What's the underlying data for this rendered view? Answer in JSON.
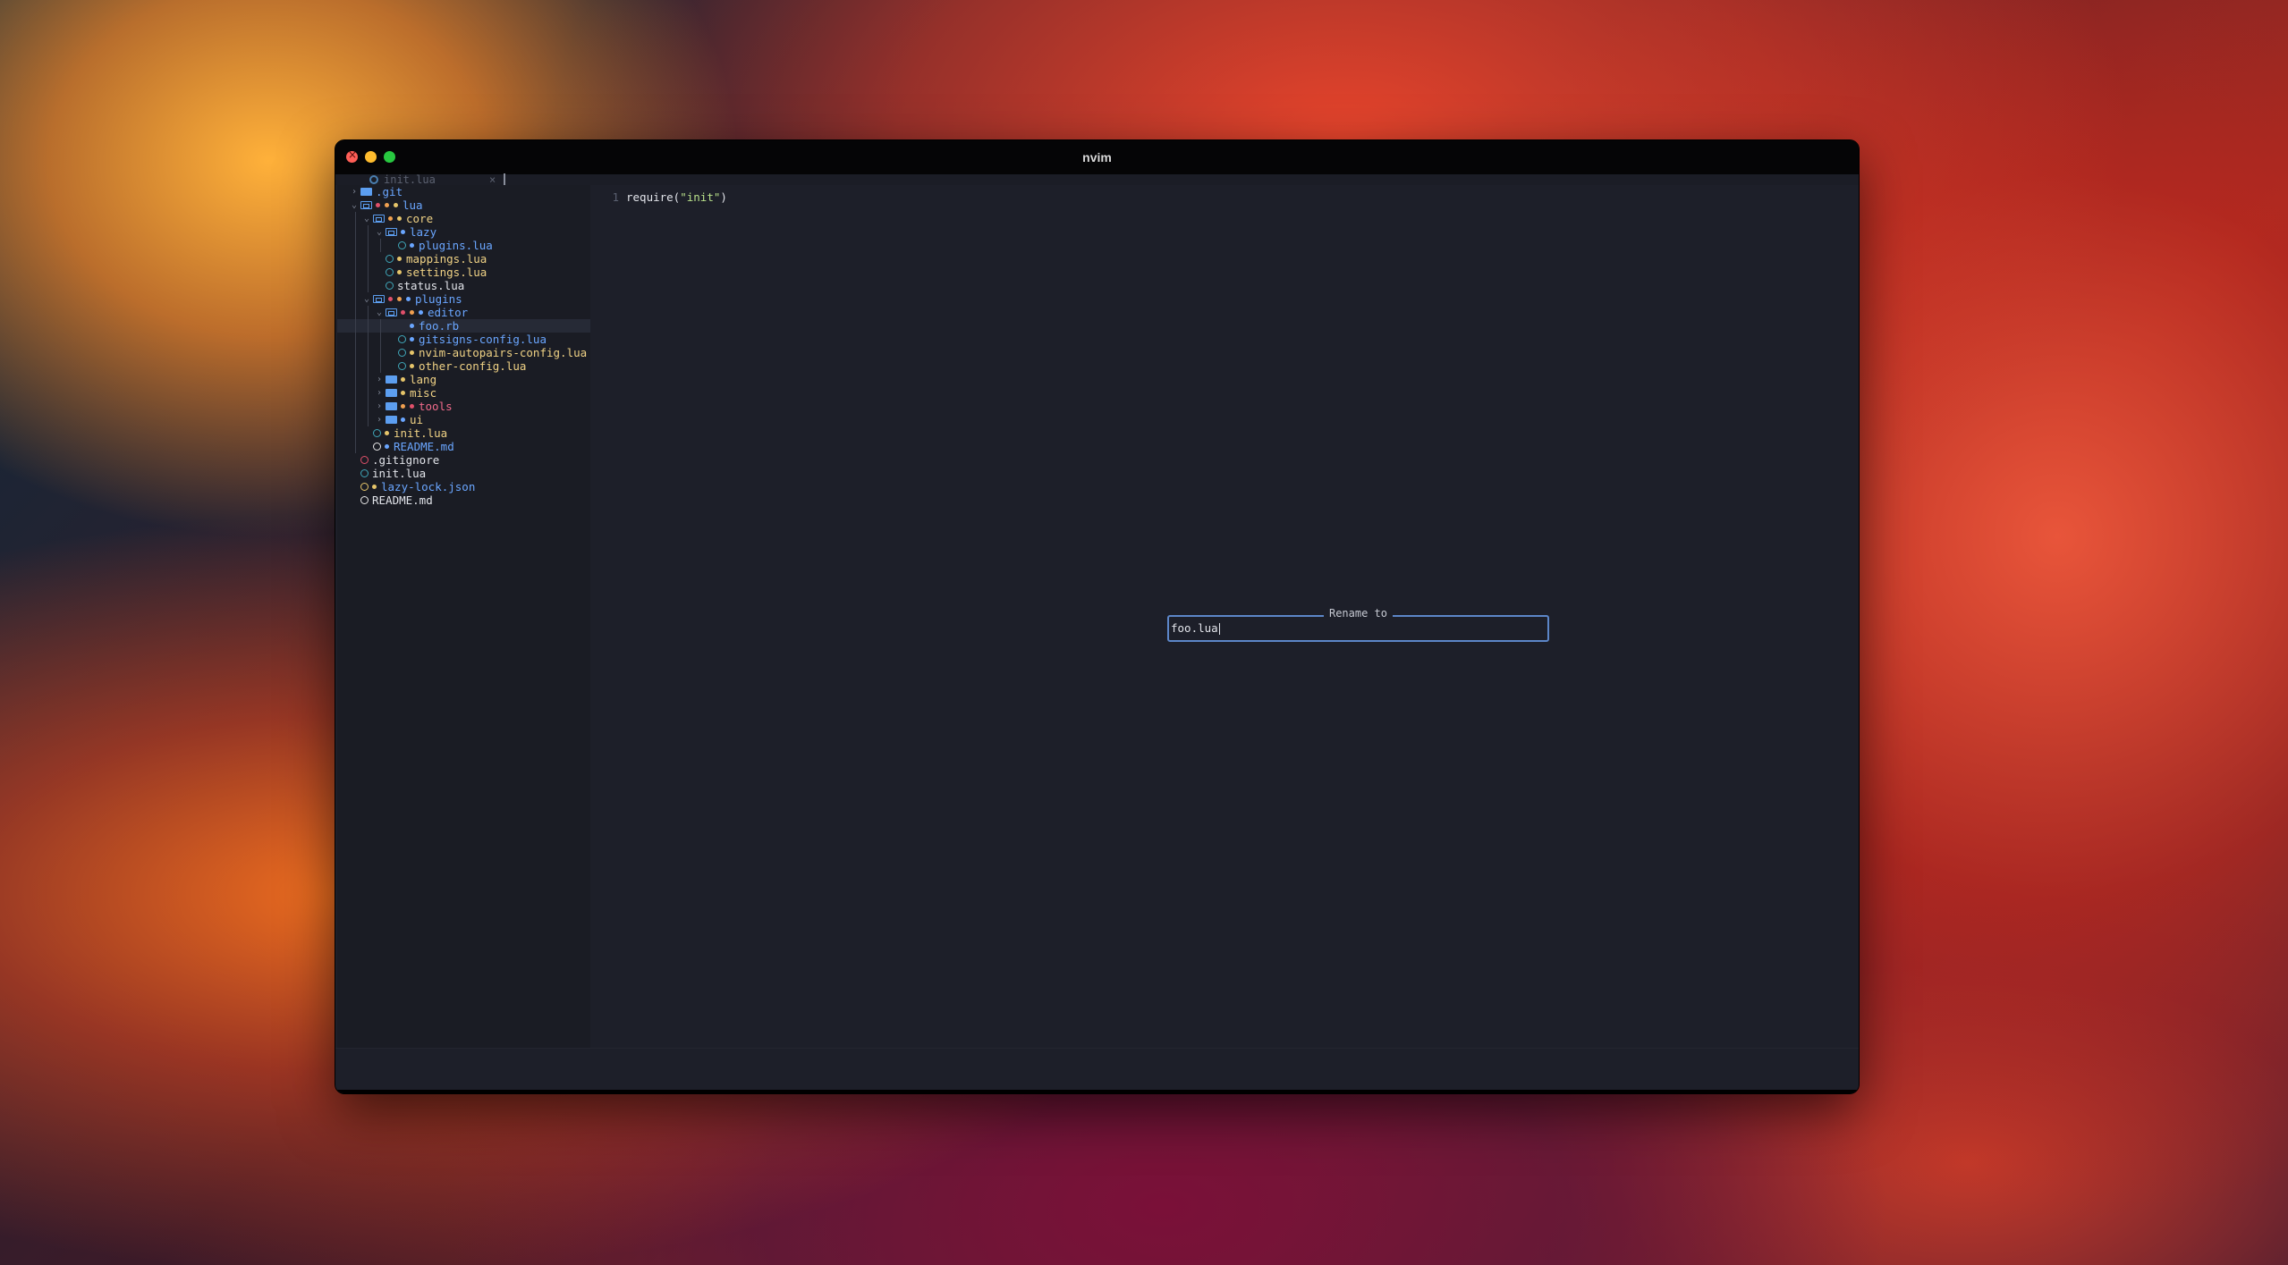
{
  "window": {
    "title": "nvim"
  },
  "tabline": {
    "tab_label": "init.lua",
    "close_glyph": "×"
  },
  "tree": [
    {
      "name": ".git",
      "kind": "folder",
      "depth": 0,
      "expanded": false,
      "color": "blue"
    },
    {
      "name": "lua",
      "kind": "folder",
      "depth": 0,
      "expanded": true,
      "color": "blue",
      "dots": [
        "#e0506a",
        "#f0a050",
        "#e6c56a"
      ]
    },
    {
      "name": "core",
      "kind": "folder",
      "depth": 1,
      "expanded": true,
      "color": "yellow",
      "dots": [
        "#f0a050",
        "#e6c56a"
      ]
    },
    {
      "name": "lazy",
      "kind": "folder",
      "depth": 2,
      "expanded": true,
      "color": "blue",
      "dots": [
        "#6aa6ff"
      ]
    },
    {
      "name": "plugins.lua",
      "kind": "file",
      "depth": 3,
      "color": "blue",
      "dots": [
        "#6aa6ff"
      ]
    },
    {
      "name": "mappings.lua",
      "kind": "file",
      "depth": 2,
      "color": "yellow",
      "dots": [
        "#e6c56a"
      ]
    },
    {
      "name": "settings.lua",
      "kind": "file",
      "depth": 2,
      "color": "yellow",
      "dots": [
        "#e6c56a"
      ]
    },
    {
      "name": "status.lua",
      "kind": "file",
      "depth": 2,
      "color": "white"
    },
    {
      "name": "plugins",
      "kind": "folder",
      "depth": 1,
      "expanded": true,
      "color": "blue",
      "dots": [
        "#e0506a",
        "#f0a050",
        "#6aa6ff"
      ]
    },
    {
      "name": "editor",
      "kind": "folder",
      "depth": 2,
      "expanded": true,
      "color": "blue",
      "dots": [
        "#e0506a",
        "#f0a050",
        "#6aa6ff"
      ]
    },
    {
      "name": "foo.rb",
      "kind": "file",
      "depth": 3,
      "color": "blue",
      "selected": true,
      "dots": [
        "#6aa6ff"
      ],
      "no_icon": true
    },
    {
      "name": "gitsigns-config.lua",
      "kind": "file",
      "depth": 3,
      "color": "blue",
      "dots": [
        "#6aa6ff"
      ]
    },
    {
      "name": "nvim-autopairs-config.lua",
      "kind": "file",
      "depth": 3,
      "color": "yellow",
      "dots": [
        "#e6c56a"
      ]
    },
    {
      "name": "other-config.lua",
      "kind": "file",
      "depth": 3,
      "color": "yellow",
      "dots": [
        "#e6c56a"
      ]
    },
    {
      "name": "lang",
      "kind": "folder",
      "depth": 2,
      "expanded": false,
      "color": "yellow",
      "dots": [
        "#e6c56a"
      ]
    },
    {
      "name": "misc",
      "kind": "folder",
      "depth": 2,
      "expanded": false,
      "color": "yellow",
      "dots": [
        "#e6c56a"
      ]
    },
    {
      "name": "tools",
      "kind": "folder",
      "depth": 2,
      "expanded": false,
      "color": "red",
      "dots": [
        "#f0a050",
        "#e0506a"
      ]
    },
    {
      "name": "ui",
      "kind": "folder",
      "depth": 2,
      "expanded": false,
      "color": "yellow",
      "dots": [
        "#6aa6ff"
      ]
    },
    {
      "name": "init.lua",
      "kind": "file",
      "depth": 1,
      "color": "yellow",
      "dots": [
        "#e6c56a"
      ]
    },
    {
      "name": "README.md",
      "kind": "file",
      "depth": 1,
      "color": "blue",
      "icon": "white",
      "dots": [
        "#6aa6ff"
      ]
    },
    {
      "name": ".gitignore",
      "kind": "file",
      "depth": 0,
      "color": "white",
      "icon": "red"
    },
    {
      "name": "init.lua",
      "kind": "file",
      "depth": 0,
      "color": "white"
    },
    {
      "name": "lazy-lock.json",
      "kind": "file",
      "depth": 0,
      "color": "blue",
      "icon": "yellow",
      "dots": [
        "#e6c56a"
      ]
    },
    {
      "name": "README.md",
      "kind": "file",
      "depth": 0,
      "color": "white",
      "icon": "white"
    }
  ],
  "editor": {
    "line_number": "1",
    "code_prefix": "require(",
    "code_string": "\"init\"",
    "code_suffix": ")"
  },
  "rename_dialog": {
    "title": "Rename to",
    "value": "foo.lua"
  }
}
